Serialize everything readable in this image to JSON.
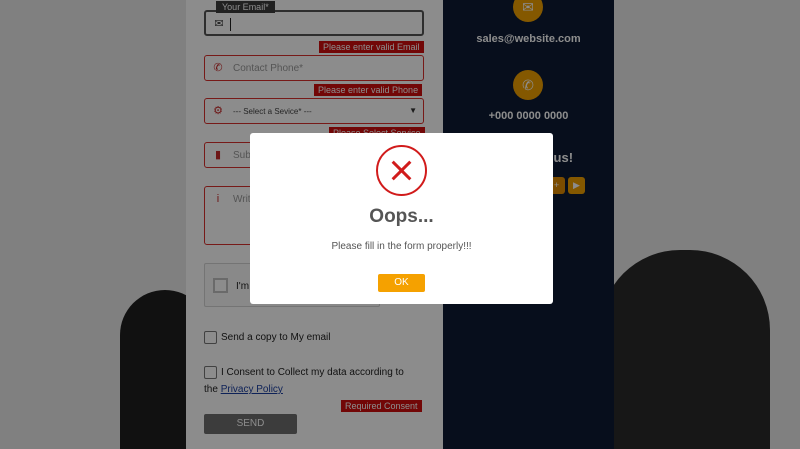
{
  "form": {
    "email_label": "Your Email*",
    "email_value": "",
    "email_error": "Please enter valid Email",
    "phone_placeholder": "Contact Phone*",
    "phone_error": "Please enter valid Phone",
    "service_placeholder": "--- Select a Sevice* ---",
    "service_error": "Please Select Service",
    "subject_placeholder": "Subj",
    "message_placeholder": "Writ",
    "recaptcha_label": "I'm n",
    "copy_label": "Send a copy to My email",
    "consent_label": "I Consent to Collect my data according to",
    "consent_prefix": "the",
    "privacy_link": "Privacy Policy",
    "consent_error": "Required Consent",
    "send_label": "SEND"
  },
  "sidebar": {
    "email": "sales@website.com",
    "phone": "+000 0000 0000",
    "follow_text": "with us!",
    "icons": [
      "envelope-icon",
      "phone-icon"
    ]
  },
  "modal": {
    "title": "Oops...",
    "message": "Please fill in the form properly!!!",
    "ok_label": "OK"
  },
  "colors": {
    "accent": "#f5a100",
    "error": "#cf0d0d",
    "sidebar_bg": "#0d1b33",
    "modal_icon": "#d11b1b"
  }
}
